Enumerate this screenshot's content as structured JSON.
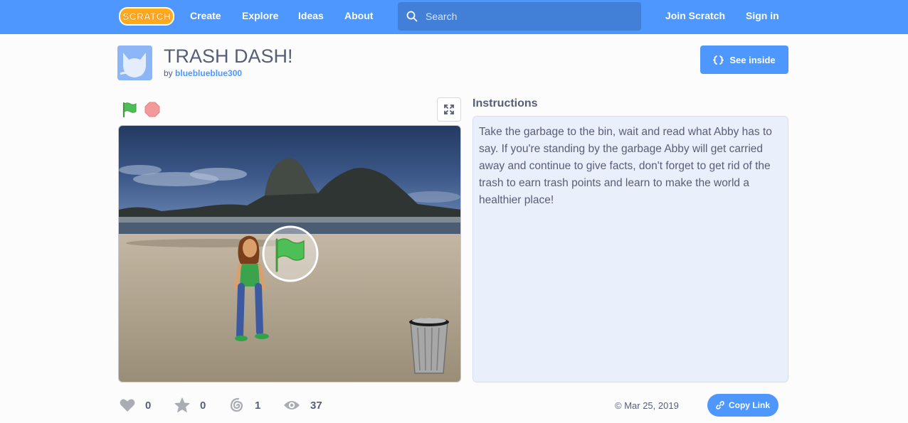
{
  "nav": {
    "logo_text": "SCRATCH",
    "links": [
      {
        "label": "Create"
      },
      {
        "label": "Explore"
      },
      {
        "label": "Ideas"
      },
      {
        "label": "About"
      }
    ],
    "search_placeholder": "Search",
    "join_label": "Join Scratch",
    "signin_label": "Sign in"
  },
  "project": {
    "title": "TRASH DASH!",
    "by_prefix": "by",
    "author": "blueblueblue300",
    "see_inside_label": "See inside"
  },
  "instructions": {
    "heading": "Instructions",
    "text": "Take the garbage to the bin, wait and read what Abby has to say. If you're standing by the garbage Abby will get carried away and continue to give facts, don't forget to get rid of the trash to earn trash points and learn to make the world a healthier place!"
  },
  "stats": {
    "loves": "0",
    "favorites": "0",
    "remixes": "1",
    "views": "37"
  },
  "date": "© Mar 25, 2019",
  "copy_link_label": "Copy Link",
  "colors": {
    "brand": "#4d97ff",
    "search_bg": "#4280d7",
    "text": "#575e75",
    "instructions_bg": "#e9f0fc",
    "green_flag": "#4cbf56",
    "stop": "#ec5959"
  },
  "icons": {
    "search": "search-icon",
    "see_inside": "see-inside-icon",
    "green_flag": "green-flag-icon",
    "stop": "stop-icon",
    "fullscreen": "fullscreen-icon",
    "love": "heart-icon",
    "favorite": "star-icon",
    "remix": "remix-icon",
    "views": "eye-icon",
    "copy_link": "link-icon"
  }
}
